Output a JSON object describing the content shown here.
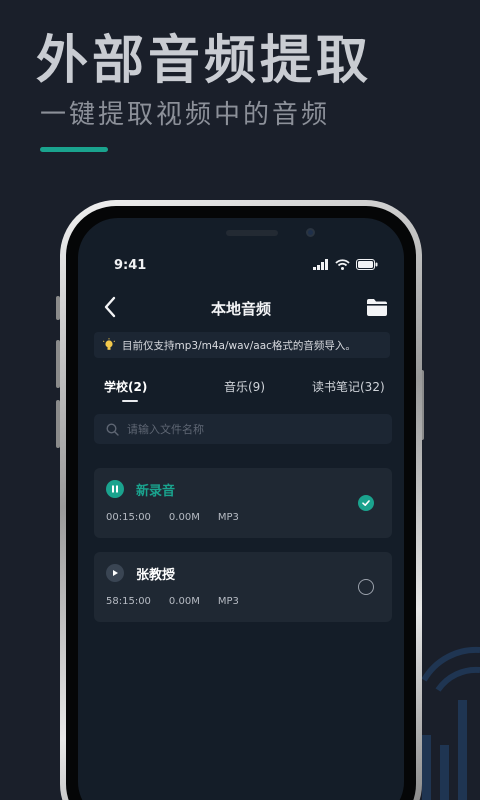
{
  "hero": {
    "title": "外部音频提取",
    "subtitle": "一键提取视频中的音频"
  },
  "status_bar": {
    "time": "9:41",
    "icons": [
      "signal-icon",
      "wifi-icon",
      "battery-icon"
    ]
  },
  "nav": {
    "title": "本地音频",
    "back_icon": "chevron-left-icon",
    "folder_icon": "folder-icon"
  },
  "notice": {
    "icon": "lightbulb-icon",
    "text": "目前仅支持mp3/m4a/wav/aac格式的音频导入。"
  },
  "tabs": [
    {
      "label": "学校(2)",
      "active": true
    },
    {
      "label": "音乐(9)",
      "active": false
    },
    {
      "label": "读书笔记(32)",
      "active": false
    }
  ],
  "search": {
    "placeholder": "请输入文件名称",
    "value": ""
  },
  "files": [
    {
      "name": "新录音",
      "duration": "00:15:00",
      "size": "0.00M",
      "format": "MP3",
      "state": "playing",
      "selected": true
    },
    {
      "name": "张教授",
      "duration": "58:15:00",
      "size": "0.00M",
      "format": "MP3",
      "state": "paused",
      "selected": false
    }
  ],
  "colors": {
    "accent": "#1aa38e",
    "background": "#1a1f2a",
    "screen": "#141d28",
    "card": "#1f2833"
  }
}
